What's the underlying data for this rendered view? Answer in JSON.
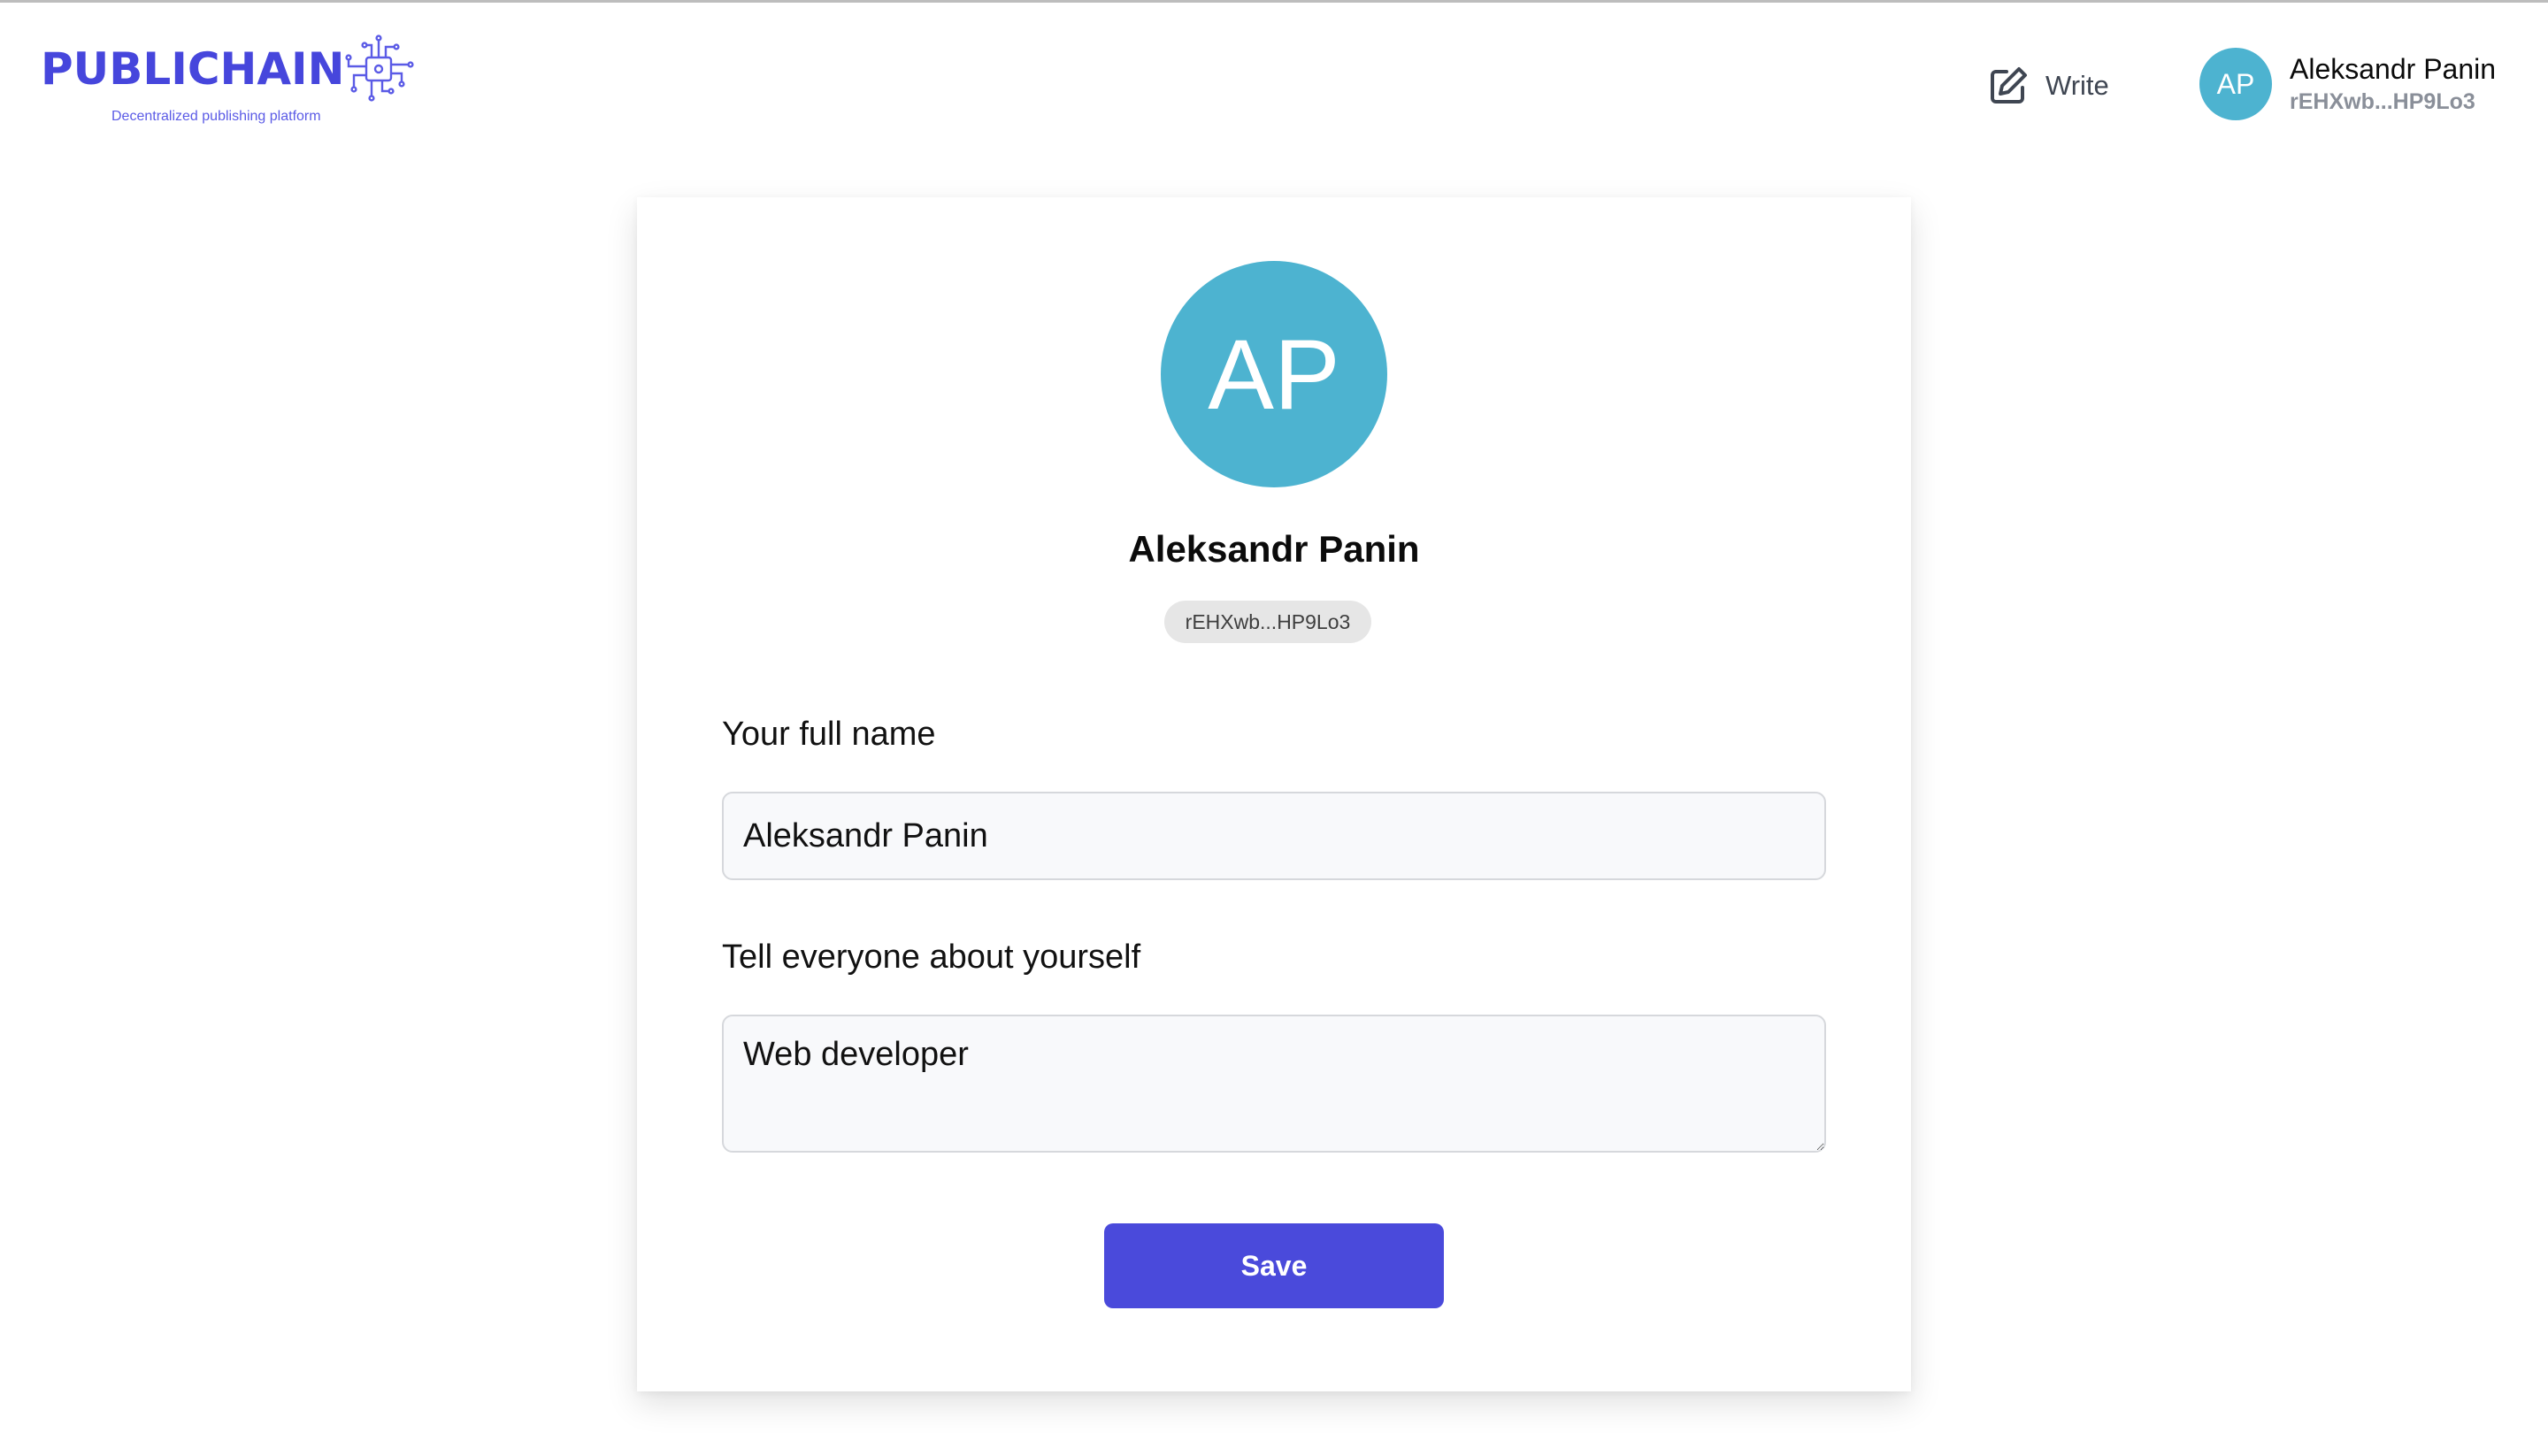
{
  "header": {
    "logo": {
      "name": "PUBLICHAIN",
      "tagline": "Decentralized publishing platform",
      "icon": "circuit-chip-icon"
    },
    "write": {
      "label": "Write",
      "icon": "pencil-square-icon"
    },
    "user": {
      "initials": "AP",
      "name": "Aleksandr Panin",
      "address": "rEHXwb...HP9Lo3"
    }
  },
  "profile": {
    "initials": "AP",
    "name": "Aleksandr Panin",
    "address": "rEHXwb...HP9Lo3",
    "fields": {
      "full_name": {
        "label": "Your full name",
        "value": "Aleksandr Panin"
      },
      "bio": {
        "label": "Tell everyone about yourself",
        "value": "Web developer"
      }
    },
    "save_label": "Save"
  },
  "colors": {
    "brand": "#4646dc",
    "avatar": "#4db3d0",
    "button": "#4a4adb"
  }
}
